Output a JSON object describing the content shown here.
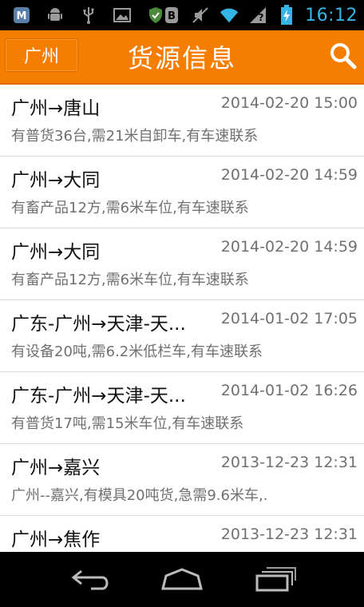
{
  "status_bar": {
    "time": "16:12",
    "left_icons": [
      "app-m-icon",
      "android-icon",
      "usb-icon",
      "image-icon",
      "shield-icon"
    ],
    "right_icons": [
      "bluetooth-icon",
      "mute-icon",
      "wifi-icon",
      "signal-icon",
      "battery-charging-icon"
    ],
    "time_color": "#33b5e5"
  },
  "header": {
    "city_button": "广州",
    "title": "货源信息",
    "search_icon": "search-icon",
    "bg_color": "#f57d00"
  },
  "list": [
    {
      "route": "广州→唐山",
      "date": "2014-02-20 15:00",
      "desc": "有普货36台,需21米自卸车,有车速联系"
    },
    {
      "route": "广州→大同",
      "date": "2014-02-20 14:59",
      "desc": "有畜产品12方,需6米车位,有车速联系"
    },
    {
      "route": "广州→大同",
      "date": "2014-02-20 14:59",
      "desc": "有畜产品12方,需6米车位,有车速联系"
    },
    {
      "route": "广东-广州→天津-天...",
      "date": "2014-01-02 17:05",
      "desc": "有设备20吨,需6.2米低栏车,有车速联系"
    },
    {
      "route": "广东-广州→天津-天...",
      "date": "2014-01-02 16:26",
      "desc": "有普货17吨,需15米车位,有车速联系"
    },
    {
      "route": "广州→嘉兴",
      "date": "2013-12-23 12:31",
      "desc": "广州--嘉兴,有模具20吨货,急需9.6米车,."
    },
    {
      "route": "广州→焦作",
      "date": "2013-12-23 12:31",
      "desc": ""
    }
  ],
  "nav_bar": {
    "buttons": [
      "back-icon",
      "home-icon",
      "recent-apps-icon"
    ]
  }
}
